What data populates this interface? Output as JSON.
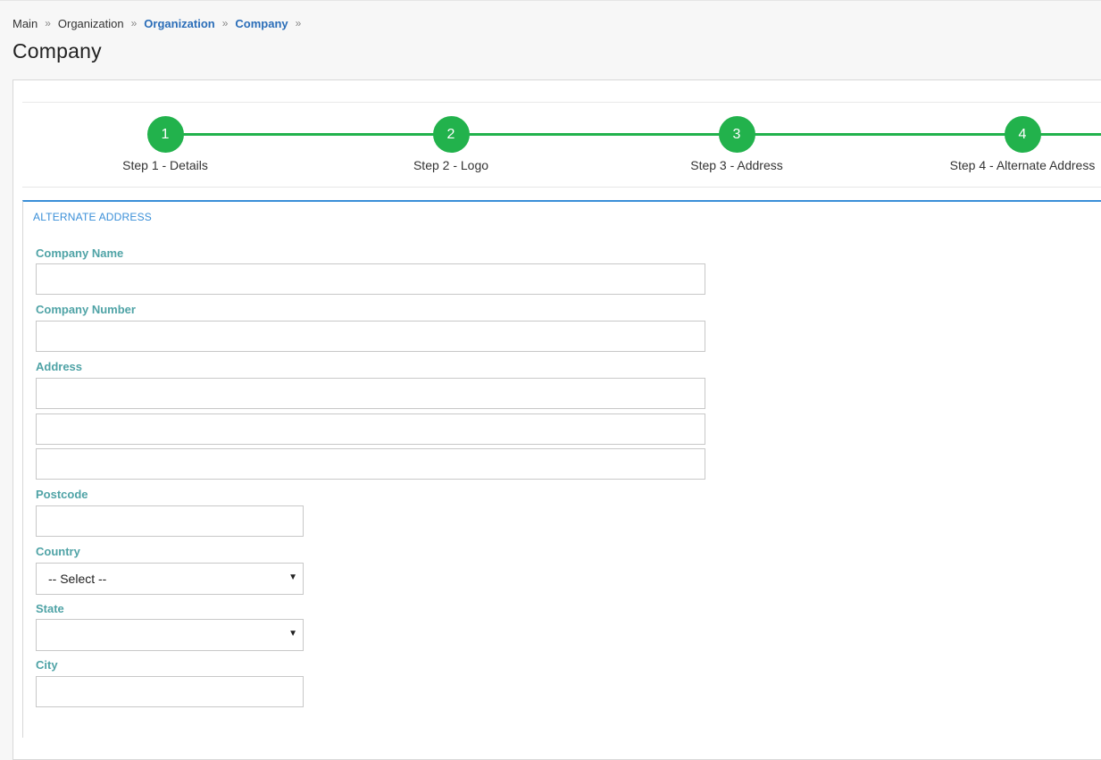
{
  "breadcrumb": {
    "items": [
      {
        "label": "Main"
      },
      {
        "label": "Organization"
      },
      {
        "label": "Organization"
      },
      {
        "label": "Company"
      }
    ],
    "separator": "»"
  },
  "page": {
    "title": "Company"
  },
  "stepper": {
    "steps": [
      {
        "number": "1",
        "label": "Step 1 - Details"
      },
      {
        "number": "2",
        "label": "Step 2 - Logo"
      },
      {
        "number": "3",
        "label": "Step 3 - Address"
      },
      {
        "number": "4",
        "label": "Step 4 - Alternate Address"
      }
    ],
    "color": "#22b24c"
  },
  "section": {
    "title": "ALTERNATE ADDRESS",
    "accent": "#3a8fd8"
  },
  "form": {
    "company_name": {
      "label": "Company Name",
      "value": ""
    },
    "company_number": {
      "label": "Company Number",
      "value": ""
    },
    "address": {
      "label": "Address",
      "line1": "",
      "line2": "",
      "line3": ""
    },
    "postcode": {
      "label": "Postcode",
      "value": ""
    },
    "country": {
      "label": "Country",
      "selected": "-- Select --"
    },
    "state": {
      "label": "State",
      "selected": ""
    },
    "city": {
      "label": "City",
      "value": ""
    }
  },
  "colors": {
    "label": "#4fa3a6",
    "link": "#2a6db8"
  }
}
